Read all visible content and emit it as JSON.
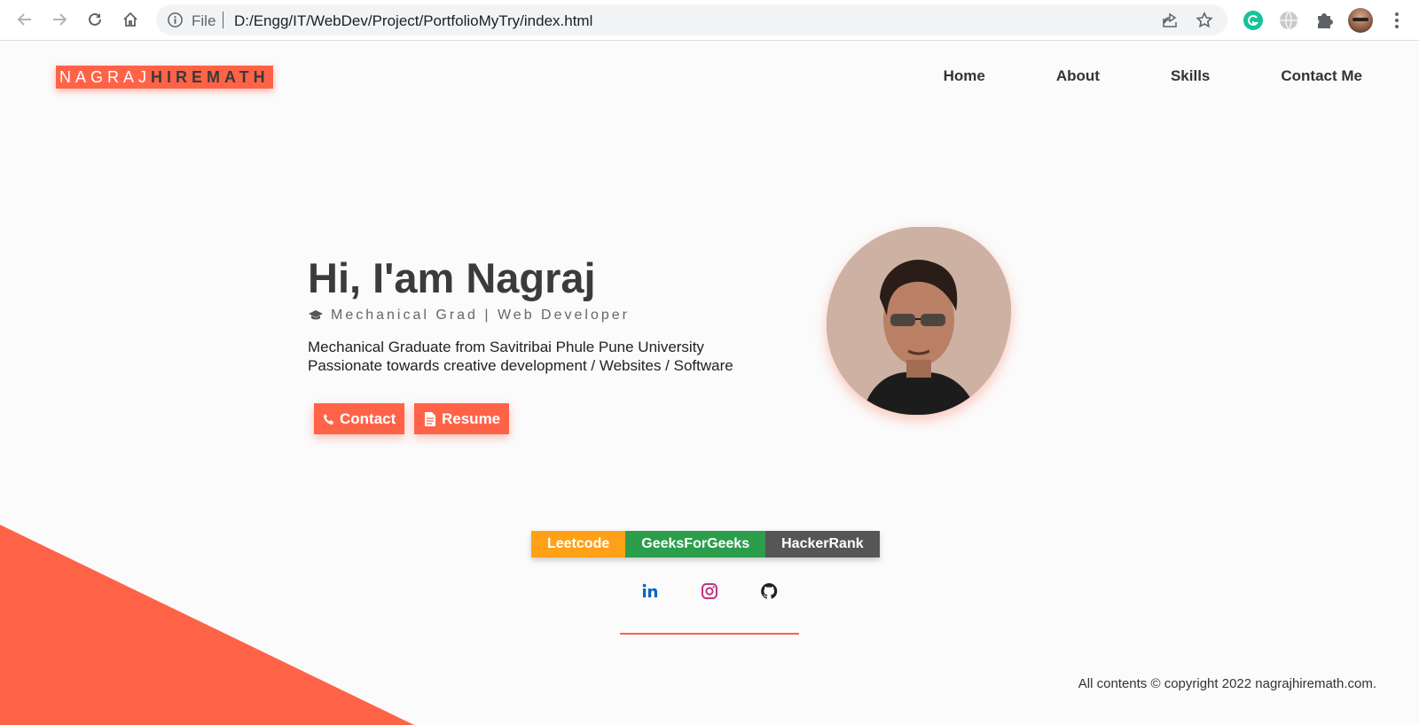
{
  "browser": {
    "file_label": "File",
    "url": "D:/Engg/IT/WebDev/Project/PortfolioMyTry/index.html"
  },
  "logo": {
    "first": "NAGRAJ",
    "last": "HIREMATH"
  },
  "nav": {
    "home": "Home",
    "about": "About",
    "skills": "Skills",
    "contact": "Contact Me"
  },
  "hero": {
    "title": "Hi, I'am Nagraj",
    "subtitle": "Mechanical Grad | Web Developer",
    "desc_line1": "Mechanical Graduate from Savitribai Phule Pune University",
    "desc_line2": "Passionate towards creative development / Websites / Software",
    "contact_btn": "Contact",
    "resume_btn": "Resume"
  },
  "profiles": {
    "leetcode": "Leetcode",
    "gfg": "GeeksForGeeks",
    "hackerrank": "HackerRank"
  },
  "socials": {
    "linkedin_color": "#0a66c2",
    "instagram_color": "#c13584",
    "github_color": "#222222"
  },
  "footer": {
    "copyright": "All contents © copyright 2022 nagrajhiremath.com."
  },
  "colors": {
    "accent": "#ff6347",
    "leetcode": "#ffa116",
    "gfg": "#2b9e4b",
    "hackerrank": "#565656"
  }
}
